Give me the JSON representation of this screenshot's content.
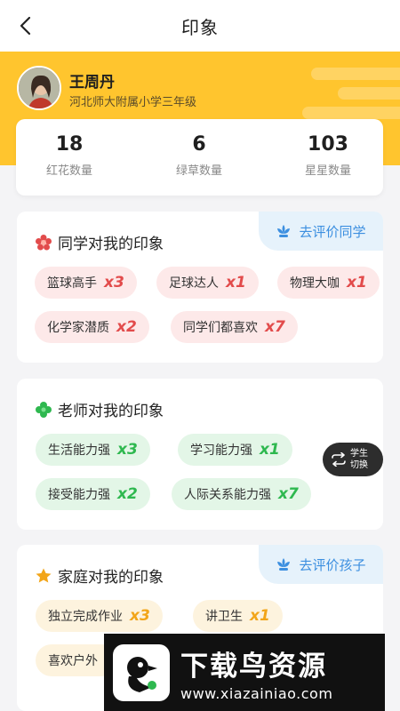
{
  "header": {
    "title": "印象"
  },
  "profile": {
    "name": "王周丹",
    "school": "河北师大附属小学三年级"
  },
  "stats": [
    {
      "value": "18",
      "label": "红花数量"
    },
    {
      "value": "6",
      "label": "绿草数量"
    },
    {
      "value": "103",
      "label": "星星数量"
    }
  ],
  "classmates": {
    "title": "同学对我的印象",
    "action": "去评价同学",
    "tags": [
      {
        "label": "篮球高手",
        "count": "x3"
      },
      {
        "label": "足球达人",
        "count": "x1"
      },
      {
        "label": "物理大咖",
        "count": "x1"
      },
      {
        "label": "化学家潜质",
        "count": "x2"
      },
      {
        "label": "同学们都喜欢",
        "count": "x7"
      }
    ]
  },
  "teachers": {
    "title": "老师对我的印象",
    "tags": [
      {
        "label": "生活能力强",
        "count": "x3"
      },
      {
        "label": "学习能力强",
        "count": "x1"
      },
      {
        "label": "接受能力强",
        "count": "x2"
      },
      {
        "label": "人际关系能力强",
        "count": "x7"
      }
    ]
  },
  "switch": {
    "line1": "学生",
    "line2": "切换"
  },
  "family": {
    "title": "家庭对我的印象",
    "action": "去评价孩子",
    "tags": [
      {
        "label": "独立完成作业",
        "count": "x3"
      },
      {
        "label": "讲卫生",
        "count": "x1"
      },
      {
        "label": "喜欢户外",
        "count": ""
      }
    ]
  },
  "watermark": {
    "title": "下载鸟资源",
    "url": "www.xiazainiao.com"
  },
  "colors": {
    "accent": "#ffc52e",
    "red": "#e24b4b",
    "green": "#2eb84f",
    "blue": "#3c8fe0",
    "orange": "#f2a519"
  }
}
